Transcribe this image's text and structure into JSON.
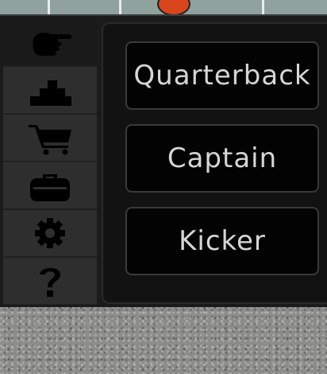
{
  "sidebar": {
    "items": [
      {
        "icon": "pointing-hand-icon",
        "active": true
      },
      {
        "icon": "stairs-icon",
        "active": false
      },
      {
        "icon": "shopping-cart-icon",
        "active": false
      },
      {
        "icon": "briefcase-icon",
        "active": false
      },
      {
        "icon": "gear-icon",
        "active": false
      },
      {
        "icon": "question-mark-icon",
        "active": false
      }
    ]
  },
  "positions": {
    "buttons": [
      "Quarterback",
      "Captain",
      "Kicker"
    ]
  },
  "colors": {
    "panel_bg": "#121212",
    "button_bg": "#030303",
    "button_text": "#d6d6d6",
    "icon": "#000000"
  }
}
